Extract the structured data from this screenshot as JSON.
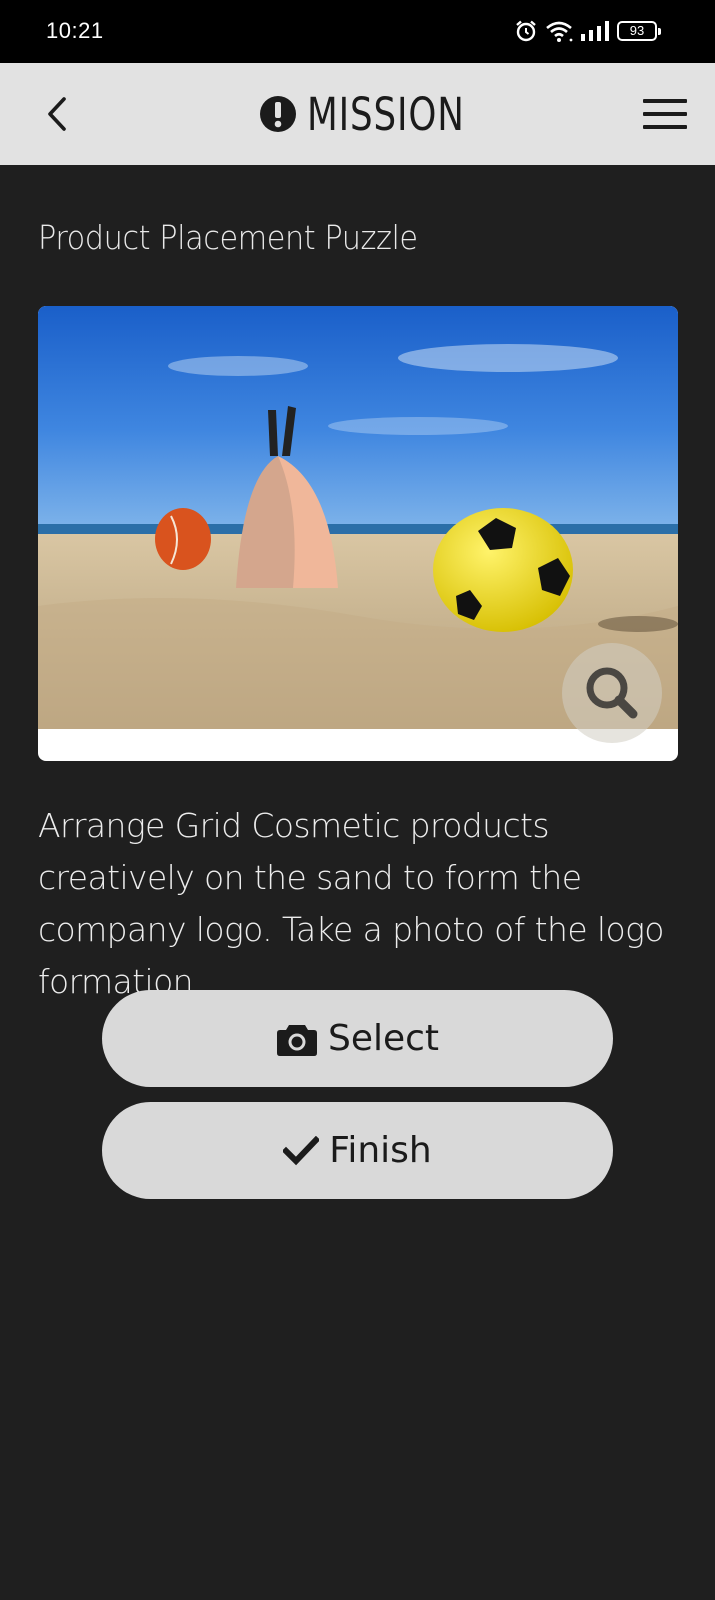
{
  "status_bar": {
    "time": "10:21",
    "battery_level": "93",
    "icons": [
      "alarm-icon",
      "wifi-icon",
      "signal-icon",
      "battery-icon"
    ]
  },
  "header": {
    "title": "MISSION",
    "back_icon": "chevron-left-icon",
    "title_icon": "exclamation-circle-icon",
    "menu_icon": "hamburger-menu-icon"
  },
  "mission": {
    "title": "Product Placement Puzzle",
    "image_icon": "search-icon",
    "description": "Arrange Grid Cosmetic products creatively on the sand to form the company logo. Take a photo of the logo formation."
  },
  "actions": {
    "select_label": "Select",
    "select_icon": "camera-icon",
    "finish_label": "Finish",
    "finish_icon": "checkmark-icon"
  },
  "colors": {
    "background": "#1f1f1f",
    "app_bar": "#e2e2e2",
    "button": "#d9d9d9",
    "text_light": "#ececec"
  }
}
